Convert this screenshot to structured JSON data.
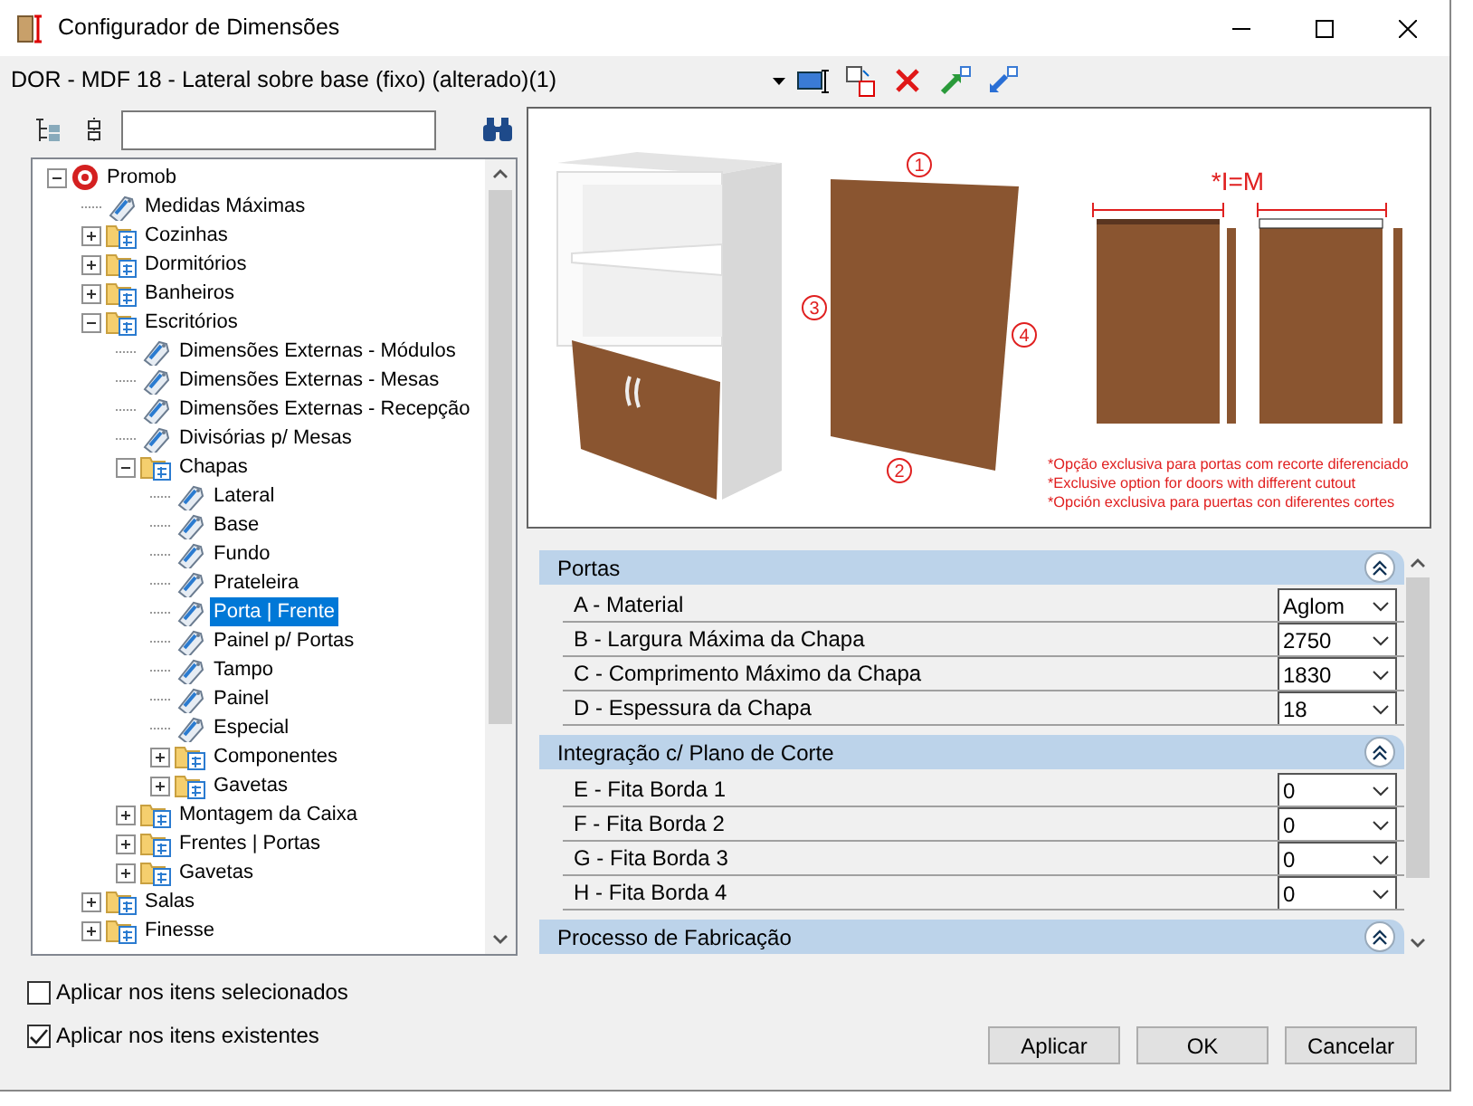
{
  "window": {
    "title": "Configurador de Dimensões"
  },
  "configuration": {
    "value": "DOR - MDF 18 - Lateral sobre base (fixo) (alterado)(1)"
  },
  "tree": [
    {
      "label": "Promob",
      "kind": "root",
      "expanded": true,
      "selected": false,
      "children": [
        {
          "label": "Medidas Máximas",
          "kind": "tag",
          "selected": false
        },
        {
          "label": "Cozinhas",
          "kind": "folder",
          "expanded": false,
          "selected": false
        },
        {
          "label": "Dormitórios",
          "kind": "folder",
          "expanded": false,
          "selected": false
        },
        {
          "label": "Banheiros",
          "kind": "folder",
          "expanded": false,
          "selected": false
        },
        {
          "label": "Escritórios",
          "kind": "folder",
          "expanded": true,
          "selected": false,
          "children": [
            {
              "label": "Dimensões Externas - Módulos",
              "kind": "tag",
              "selected": false
            },
            {
              "label": "Dimensões Externas - Mesas",
              "kind": "tag",
              "selected": false
            },
            {
              "label": "Dimensões Externas - Recepção",
              "kind": "tag",
              "selected": false
            },
            {
              "label": "Divisórias p/ Mesas",
              "kind": "tag",
              "selected": false
            },
            {
              "label": "Chapas",
              "kind": "folder",
              "expanded": true,
              "selected": false,
              "children": [
                {
                  "label": "Lateral",
                  "kind": "tag",
                  "selected": false
                },
                {
                  "label": "Base",
                  "kind": "tag",
                  "selected": false
                },
                {
                  "label": "Fundo",
                  "kind": "tag",
                  "selected": false
                },
                {
                  "label": "Prateleira",
                  "kind": "tag",
                  "selected": false
                },
                {
                  "label": "Porta | Frente",
                  "kind": "tag",
                  "selected": true
                },
                {
                  "label": "Painel p/ Portas",
                  "kind": "tag",
                  "selected": false
                },
                {
                  "label": "Tampo",
                  "kind": "tag",
                  "selected": false
                },
                {
                  "label": "Painel",
                  "kind": "tag",
                  "selected": false
                },
                {
                  "label": "Especial",
                  "kind": "tag",
                  "selected": false
                },
                {
                  "label": "Componentes",
                  "kind": "folder",
                  "expanded": false,
                  "selected": false
                },
                {
                  "label": "Gavetas",
                  "kind": "folder",
                  "expanded": false,
                  "selected": false
                }
              ]
            },
            {
              "label": "Montagem da Caixa",
              "kind": "folder",
              "expanded": false,
              "selected": false
            },
            {
              "label": "Frentes | Portas",
              "kind": "folder",
              "expanded": false,
              "selected": false
            },
            {
              "label": "Gavetas",
              "kind": "folder",
              "expanded": false,
              "selected": false
            }
          ]
        },
        {
          "label": "Salas",
          "kind": "folder",
          "expanded": false,
          "selected": false
        },
        {
          "label": "Finesse",
          "kind": "folder",
          "expanded": false,
          "selected": false
        }
      ]
    }
  ],
  "options": [
    {
      "label": "Aplicar nos itens selecionados",
      "checked": false
    },
    {
      "label": "Aplicar nos itens existentes",
      "checked": true
    }
  ],
  "illustration": {
    "edge_numbers": [
      "1",
      "2",
      "3",
      "4"
    ],
    "equality_label": "*I=M",
    "notes": [
      "*Opção exclusiva para portas com recorte diferenciado",
      "*Exclusive option for doors with different cutout",
      "*Opción exclusiva para puertas con diferentes cortes"
    ]
  },
  "properties": [
    {
      "title": "Portas",
      "expanded": true,
      "rows": [
        {
          "label": "A - Material",
          "value": "Aglom"
        },
        {
          "label": "B - Largura Máxima da Chapa",
          "value": "2750"
        },
        {
          "label": "C - Comprimento Máximo da Chapa",
          "value": "1830"
        },
        {
          "label": "D - Espessura da Chapa",
          "value": "18"
        }
      ]
    },
    {
      "title": "Integração c/ Plano de Corte",
      "expanded": true,
      "rows": [
        {
          "label": "E - Fita Borda 1",
          "value": "0"
        },
        {
          "label": "F - Fita Borda 2",
          "value": "0"
        },
        {
          "label": "G - Fita Borda 3",
          "value": "0"
        },
        {
          "label": "H - Fita Borda 4",
          "value": "0"
        }
      ]
    },
    {
      "title": "Processo de Fabricação",
      "expanded": true
    }
  ],
  "buttons": [
    "Aplicar",
    "OK",
    "Cancelar"
  ]
}
